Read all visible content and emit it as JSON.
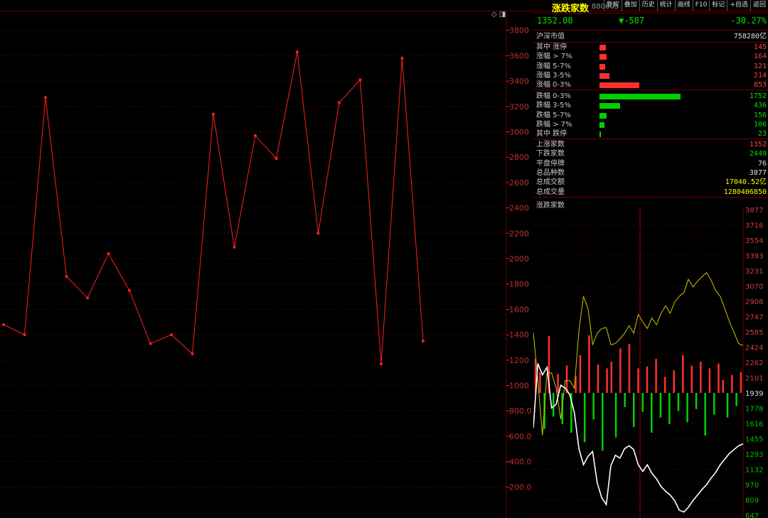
{
  "toolbar": {
    "buttons": [
      "复权",
      "叠加",
      "历史",
      "统计",
      "画线",
      "F10",
      "标记",
      "+自选",
      "返回"
    ]
  },
  "corner_icons": "◇ ◨",
  "quote": {
    "title": "涨跌家数",
    "code": "880005",
    "price": "1352.00",
    "change": "▼-587",
    "change_pct": "-30.27%"
  },
  "market_value": {
    "label": "沪深市值",
    "value": "758280亿"
  },
  "up_rows": [
    {
      "label": "其中  涨停",
      "value": "145",
      "bar_pct": 0.08
    },
    {
      "label": "涨幅 > 7%",
      "value": "164",
      "bar_pct": 0.09
    },
    {
      "label": "涨幅 5-7%",
      "value": "121",
      "bar_pct": 0.07
    },
    {
      "label": "涨幅 3-5%",
      "value": "214",
      "bar_pct": 0.12
    },
    {
      "label": "涨幅 0-3%",
      "value": "853",
      "bar_pct": 0.49
    }
  ],
  "down_rows": [
    {
      "label": "跌幅 0-3%",
      "value": "1752",
      "bar_pct": 1.0
    },
    {
      "label": "跌幅 3-5%",
      "value": "436",
      "bar_pct": 0.25
    },
    {
      "label": "跌幅 5-7%",
      "value": "156",
      "bar_pct": 0.09
    },
    {
      "label": "跌幅 > 7%",
      "value": "106",
      "bar_pct": 0.06
    },
    {
      "label": "其中  跌停",
      "value": "23",
      "bar_pct": 0.015
    }
  ],
  "stats": [
    {
      "label": "上涨家数",
      "value": "1352",
      "color": "red"
    },
    {
      "label": "下跌家数",
      "value": "2449",
      "color": "green"
    },
    {
      "label": "平盘停牌",
      "value": "76",
      "color": "white"
    },
    {
      "label": "总品种数",
      "value": "3877",
      "color": "white"
    },
    {
      "label": "总成交额",
      "value": "17040.52亿",
      "color": "yellow"
    },
    {
      "label": "总成交量",
      "value": "1280406850",
      "color": "yellow"
    }
  ],
  "mini_chart_title": "涨跌家数",
  "colors": {
    "background": "#000000",
    "line_red": "#ff2020",
    "grid": "#6a0000",
    "up": "#ff3030",
    "down": "#00d000",
    "yellow_line": "#c8c800"
  },
  "chart_data": [
    {
      "type": "line",
      "ylim": [
        0,
        4000
      ],
      "y_ticks": [
        "200.0",
        "400.0",
        "600.0",
        "800.0",
        "1000",
        "1200",
        "1400",
        "1600",
        "1800",
        "2000",
        "2200",
        "2400",
        "2600",
        "2800",
        "3000",
        "3200",
        "3400",
        "3600",
        "3800"
      ],
      "y_tick_values": [
        200,
        400,
        600,
        800,
        1000,
        1200,
        1400,
        1600,
        1800,
        2000,
        2200,
        2400,
        2600,
        2800,
        3000,
        3200,
        3400,
        3600,
        3800
      ],
      "values": [
        1480,
        1400,
        3270,
        1860,
        1690,
        2040,
        1750,
        1330,
        1400,
        1250,
        3140,
        2090,
        2970,
        2790,
        3630,
        2200,
        3230,
        3410,
        1170,
        3580,
        1350
      ],
      "grid": true
    },
    {
      "type": "line",
      "ylim": [
        647,
        3877
      ],
      "y_ticks": [
        "3877",
        "3716",
        "3554",
        "3393",
        "3231",
        "3070",
        "2908",
        "2747",
        "2585",
        "2424",
        "2262",
        "2101",
        "1939",
        "1778",
        "1616",
        "1455",
        "1293",
        "1132",
        "970",
        "809",
        "647"
      ],
      "midline": 1939,
      "series": [
        {
          "color": "yellow",
          "values": [
            2580,
            2060,
            1490,
            2150,
            2150,
            1990,
            1660,
            2070,
            2070,
            1990,
            2600,
            2960,
            2830,
            2450,
            2570,
            2620,
            2630,
            2450,
            2460,
            2510,
            2570,
            2650,
            2570,
            2770,
            2690,
            2620,
            2730,
            2660,
            2780,
            2860,
            2780,
            2900,
            2960,
            3000,
            3140,
            3060,
            3120,
            3170,
            3210,
            3130,
            3020,
            2960,
            2830,
            2690,
            2580,
            2460,
            2440
          ]
        },
        {
          "color": "white",
          "values": [
            1570,
            2250,
            2130,
            2210,
            1780,
            1820,
            2020,
            1990,
            1920,
            1730,
            1350,
            1180,
            1270,
            1320,
            990,
            830,
            760,
            1170,
            1280,
            1250,
            1350,
            1380,
            1340,
            1180,
            1110,
            1180,
            1090,
            1030,
            950,
            900,
            860,
            800,
            700,
            680,
            730,
            800,
            860,
            920,
            970,
            1040,
            1100,
            1180,
            1240,
            1300,
            1340,
            1380,
            1400
          ]
        }
      ],
      "bars": [
        360,
        220,
        -380,
        600,
        -250,
        200,
        -330,
        290,
        -420,
        180,
        400,
        -520,
        610,
        -280,
        300,
        -610,
        260,
        330,
        -470,
        470,
        -150,
        520,
        -360,
        260,
        -200,
        280,
        -420,
        360,
        -260,
        170,
        -330,
        240,
        -190,
        400,
        -310,
        290,
        -170,
        330,
        -450,
        260,
        -230,
        310,
        140,
        -260,
        190,
        -140,
        220
      ]
    }
  ]
}
